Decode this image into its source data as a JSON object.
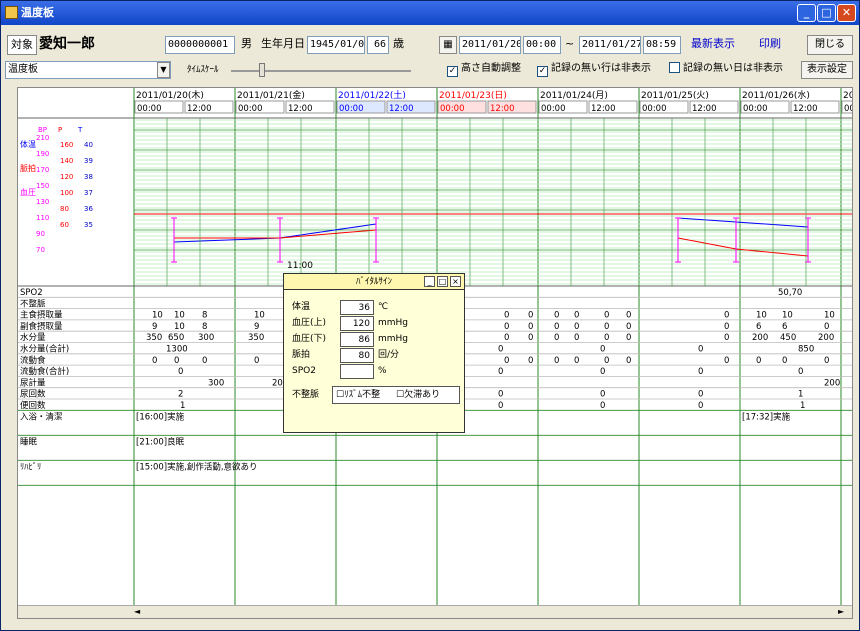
{
  "window": {
    "title": "温度板"
  },
  "header": {
    "subject_label": "対象",
    "patient_name": "愛知一郎",
    "patient_id": "0000000001",
    "sex": "男",
    "birth_label": "生年月日",
    "birth_date": "1945/01/01",
    "age": "66",
    "age_unit": "歳",
    "from_date": "2011/01/20",
    "from_time": "00:00",
    "range_sep": "~",
    "to_date": "2011/01/27",
    "to_time": "08:59",
    "refresh_label": "最新表示",
    "print_label": "印刷",
    "close_label": "閉じる"
  },
  "toolbar": {
    "view_select": "温度板",
    "time_scale_label": "ﾀｲﾑｽｹｰﾙ",
    "auto_height_label": "高さ自動調整",
    "hide_empty_rows_label": "記録の無い行は非表示",
    "hide_empty_days_label": "記録の無い日は非表示",
    "auto_height_checked": true,
    "hide_empty_rows_checked": true,
    "hide_empty_days_checked": false,
    "display_settings_label": "表示設定"
  },
  "dates": [
    {
      "date": "2011/01/20(木)",
      "color": "#000000"
    },
    {
      "date": "2011/01/21(金)",
      "color": "#000000"
    },
    {
      "date": "2011/01/22(土)",
      "color": "#0000ff"
    },
    {
      "date": "2011/01/23(日)",
      "color": "#ff0000"
    },
    {
      "date": "2011/01/24(月)",
      "color": "#000000"
    },
    {
      "date": "2011/01/25(火)",
      "color": "#000000"
    },
    {
      "date": "2011/01/26(水)",
      "color": "#000000"
    },
    {
      "date": "201",
      "color": "#000000"
    }
  ],
  "times": [
    "00:00",
    "12:00"
  ],
  "vitals_axis": {
    "headers": [
      "BP",
      "P",
      "T"
    ],
    "legend": [
      {
        "label": "体温",
        "color": "#0000ff"
      },
      {
        "label": "脈拍",
        "color": "#ff0000"
      },
      {
        "label": "血圧",
        "color": "#ff00ff"
      }
    ],
    "bp_ticks": [
      "210",
      "190",
      "170",
      "150",
      "130",
      "110",
      "90",
      "70"
    ],
    "p_ticks": [
      "160",
      "140",
      "120",
      "100",
      "80",
      "60"
    ],
    "t_ticks": [
      "40",
      "39",
      "38",
      "37",
      "36",
      "35"
    ]
  },
  "row_labels": [
    "SPO2",
    "不整脈",
    "主食摂取量",
    "副食摂取量",
    "水分量",
    "水分量(合計)",
    "流動食",
    "流動食(合計)",
    "尿計量",
    "尿回数",
    "便回数",
    "入浴・清潔",
    "睡眠",
    "ﾘﾊﾋﾞﾘ"
  ],
  "cells": {
    "spo2": "50,70",
    "main_food": [
      "10",
      "10",
      "8",
      "10",
      "0",
      "0",
      "0",
      "0",
      "0",
      "0",
      "0",
      "10",
      "10",
      "10"
    ],
    "side_food": [
      "9",
      "10",
      "8",
      "9",
      "0",
      "0",
      "0",
      "0",
      "0",
      "0",
      "0",
      "6",
      "6",
      "0"
    ],
    "water": [
      "350",
      "650",
      "300",
      "350",
      "0",
      "0",
      "0",
      "0",
      "0",
      "0",
      "0",
      "200",
      "450",
      "200"
    ],
    "water_total": [
      "1300",
      "10",
      "0",
      "0",
      "0",
      "850"
    ],
    "liquid_food": [
      "0",
      "0",
      "0",
      "0",
      "0",
      "0",
      "0",
      "0",
      "0",
      "0",
      "0",
      "0",
      "0",
      "0"
    ],
    "liquid_total": [
      "0",
      "0",
      "0",
      "0",
      "0",
      "0"
    ],
    "urine_volume": [
      "300",
      "20",
      "200"
    ],
    "urine_count": [
      "2",
      "8",
      "0",
      "0",
      "0",
      "1"
    ],
    "stool_count": [
      "1",
      "1",
      "1",
      "0",
      "0",
      "0",
      "1"
    ],
    "bath": [
      "[16:00]実施",
      "[17:32]実施"
    ],
    "sleep": "[21:00]良眠",
    "rehab": "[15:00]実施,創作活動,意欲あり"
  },
  "popup": {
    "title": "ﾊﾞｲﾀﾙｻｲﾝ",
    "time_label": "11:00",
    "fields": [
      {
        "label": "体温",
        "value": "36",
        "unit": "℃"
      },
      {
        "label": "血圧(上)",
        "value": "120",
        "unit": "mmHg"
      },
      {
        "label": "血圧(下)",
        "value": "86",
        "unit": "mmHg"
      },
      {
        "label": "脈拍",
        "value": "80",
        "unit": "回/分"
      },
      {
        "label": "SPO2",
        "value": "",
        "unit": "%"
      }
    ],
    "arrhythmia_label": "不整脈",
    "arrhythmia_opt1": "ﾘｽﾞﾑ不整",
    "arrhythmia_opt2": "欠滞あり"
  }
}
